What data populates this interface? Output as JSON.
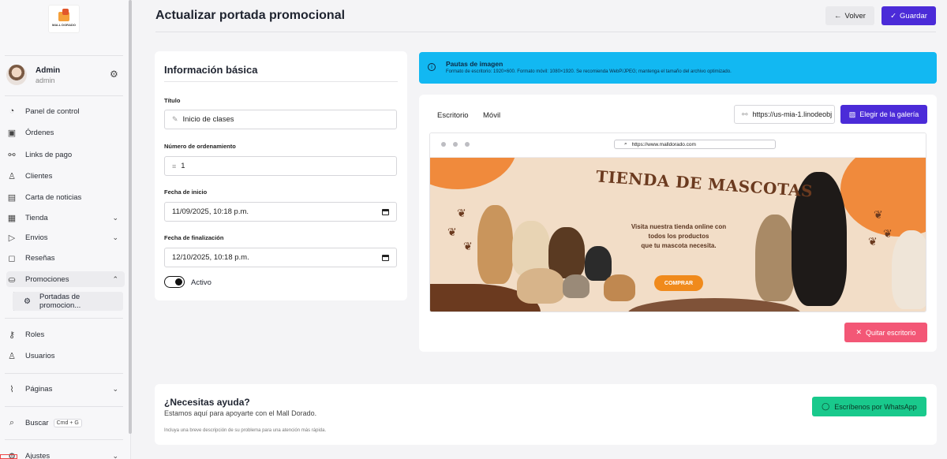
{
  "brand": {
    "logo_text": "MALL DORADO"
  },
  "user": {
    "name": "Admin",
    "role": "admin"
  },
  "sidebar": {
    "items": [
      {
        "label": "Panel de control",
        "icon": "dashboard-icon"
      },
      {
        "label": "Órdenes",
        "icon": "gift-icon"
      },
      {
        "label": "Links de pago",
        "icon": "link-icon"
      },
      {
        "label": "Clientes",
        "icon": "user-icon"
      },
      {
        "label": "Carta de noticias",
        "icon": "newspaper-icon"
      },
      {
        "label": "Tienda",
        "icon": "store-icon"
      },
      {
        "label": "Envios",
        "icon": "send-icon"
      },
      {
        "label": "Reseñas",
        "icon": "chat-icon"
      },
      {
        "label": "Promociones",
        "icon": "promo-icon"
      },
      {
        "label": "Portadas de promocion...",
        "icon": "image-gear-icon"
      },
      {
        "label": "Roles",
        "icon": "key-icon"
      },
      {
        "label": "Usuarios",
        "icon": "users-icon"
      },
      {
        "label": "Páginas",
        "icon": "paperclip-icon"
      },
      {
        "label": "Buscar",
        "icon": "search-icon"
      },
      {
        "label": "Ajustes",
        "icon": "settings-icon"
      }
    ],
    "search_shortcut": "Cmd + G"
  },
  "header": {
    "title": "Actualizar portada promocional",
    "back_label": "Volver",
    "save_label": "Guardar"
  },
  "form": {
    "title": "Información básica",
    "title_label": "Título",
    "title_value": "Inicio de clases",
    "order_label": "Número de ordenamiento",
    "order_value": "1",
    "start_label": "Fecha de inicio",
    "start_value": "11/09/2025, 10:18 p.m.",
    "end_label": "Fecha de finalización",
    "end_value": "12/10/2025, 10:18 p.m.",
    "active_label": "Activo",
    "active": true
  },
  "guidelines": {
    "title": "Pautas de imagen",
    "text": "Formato de escritorio: 1920×600. Formato móvil: 1080×1920. Se recomienda WebP/JPEG; mantenga el tamaño del archivo optimizado."
  },
  "preview": {
    "tab_desktop": "Escritorio",
    "tab_mobile": "Móvil",
    "url_value": "https://us-mia-1.linodeobj",
    "gallery_label": "Elegir de la galería",
    "address": "https://www.malldorado.com",
    "banner_title": "TIENDA DE MASCOTAS",
    "banner_lines": [
      "Visita nuestra tienda online con",
      "todos los productos",
      "que tu mascota necesita."
    ],
    "banner_cta": "COMPRAR",
    "remove_label": "Quitar escritorio"
  },
  "help": {
    "title": "¿Necesitas ayuda?",
    "subtitle": "Estamos aquí para apoyarte con el Mall Dorado.",
    "note": "Incluya una breve descripción de su problema para una atención más rápida.",
    "button": "Escríbenos por WhatsApp"
  },
  "colors": {
    "primary": "#4b2bd8",
    "info": "#12b8f2",
    "danger": "#f35776",
    "whatsapp": "#19c98c",
    "banner_orange": "#f08a3c",
    "banner_brown": "#6b3a1f"
  }
}
